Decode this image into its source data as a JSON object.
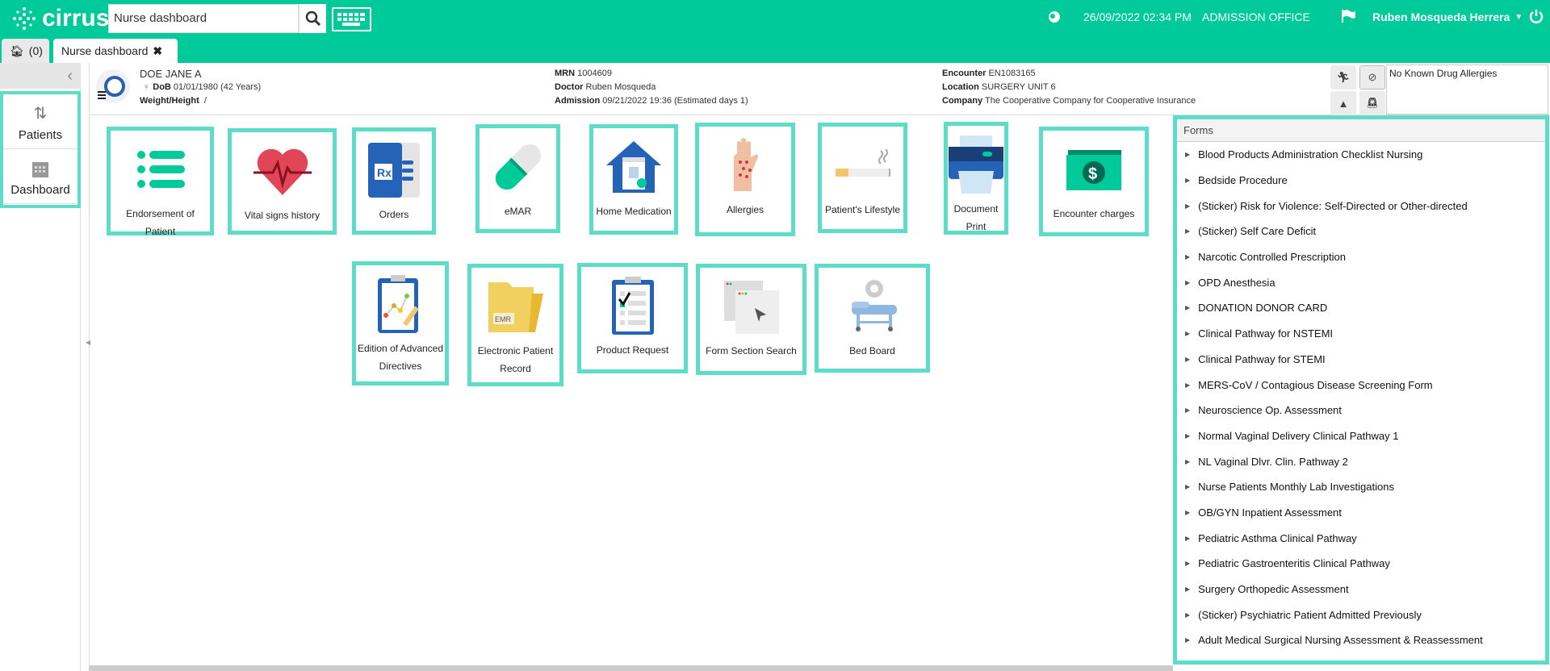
{
  "app": {
    "brand": "cirrus",
    "search_value": "Nurse dashboard"
  },
  "header": {
    "datetime": "26/09/2022 02:34 PM",
    "office": "ADMISSION OFFICE",
    "user": "Ruben Mosqueda Herrera"
  },
  "tabs": [
    {
      "label": "(0)"
    },
    {
      "label": "Nurse dashboard"
    }
  ],
  "sidebar": {
    "items": [
      {
        "label": "Patients"
      },
      {
        "label": "Dashboard"
      }
    ]
  },
  "patient": {
    "name": "DOE JANE A",
    "dob_label": "DoB",
    "dob": "01/01/1980 (42 Years)",
    "weight_label": "Weight/Height",
    "weight": "/",
    "mrn_label": "MRN",
    "mrn": "1004609",
    "doctor_label": "Doctor",
    "doctor": "Ruben Mosqueda",
    "admission_label": "Admission",
    "admission": "09/21/2022 19:36 (Estimated days 1)",
    "encounter_label": "Encounter",
    "encounter": "EN1083165",
    "location_label": "Location",
    "location": "SURGERY UNIT 6",
    "company_label": "Company",
    "company": "The Cooperative Company for Cooperative Insurance",
    "allergies": "No Known Drug Allergies"
  },
  "tiles": [
    {
      "label": "Endorsement of Patient"
    },
    {
      "label": "Vital signs history"
    },
    {
      "label": "Orders"
    },
    {
      "label": "eMAR"
    },
    {
      "label": "Home Medication"
    },
    {
      "label": "Allergies"
    },
    {
      "label": "Patient's Lifestyle"
    },
    {
      "label": "Document Print"
    },
    {
      "label": "Encounter charges"
    },
    {
      "label": "Edition of Advanced Directives"
    },
    {
      "label": "Electronic Patient Record"
    },
    {
      "label": "Product Request"
    },
    {
      "label": "Form Section Search"
    },
    {
      "label": "Bed Board"
    }
  ],
  "tile_icon_text": {
    "rx": "Rx",
    "emr": "EMR"
  },
  "forms": {
    "title": "Forms",
    "items": [
      "Blood Products Administration Checklist Nursing",
      "Bedside Procedure",
      "(Sticker) Risk for Violence: Self-Directed or Other-directed",
      "(Sticker) Self Care Deficit",
      "Narcotic Controlled Prescription",
      "OPD Anesthesia",
      "DONATION DONOR CARD",
      "Clinical Pathway for NSTEMI",
      "Clinical Pathway for STEMI",
      "MERS-CoV / Contagious Disease Screening Form",
      "Neuroscience Op. Assessment",
      "Normal Vaginal Delivery Clinical Pathway 1",
      "NL Vaginal Dlvr. Clin. Pathway 2",
      "Nurse Patients Monthly Lab Investigations",
      "OB/GYN Inpatient Assessment",
      "Pediatric Asthma Clinical Pathway",
      "Pediatric Gastroenteritis Clinical Pathway",
      "Surgery Orthopedic Assessment",
      "(Sticker) Psychiatric Patient Admitted Previously",
      "Adult Medical Surgical Nursing Assessment & Reassessment"
    ]
  },
  "colors": {
    "brand": "#00c99a",
    "tile_border": "#5ddcc8"
  }
}
